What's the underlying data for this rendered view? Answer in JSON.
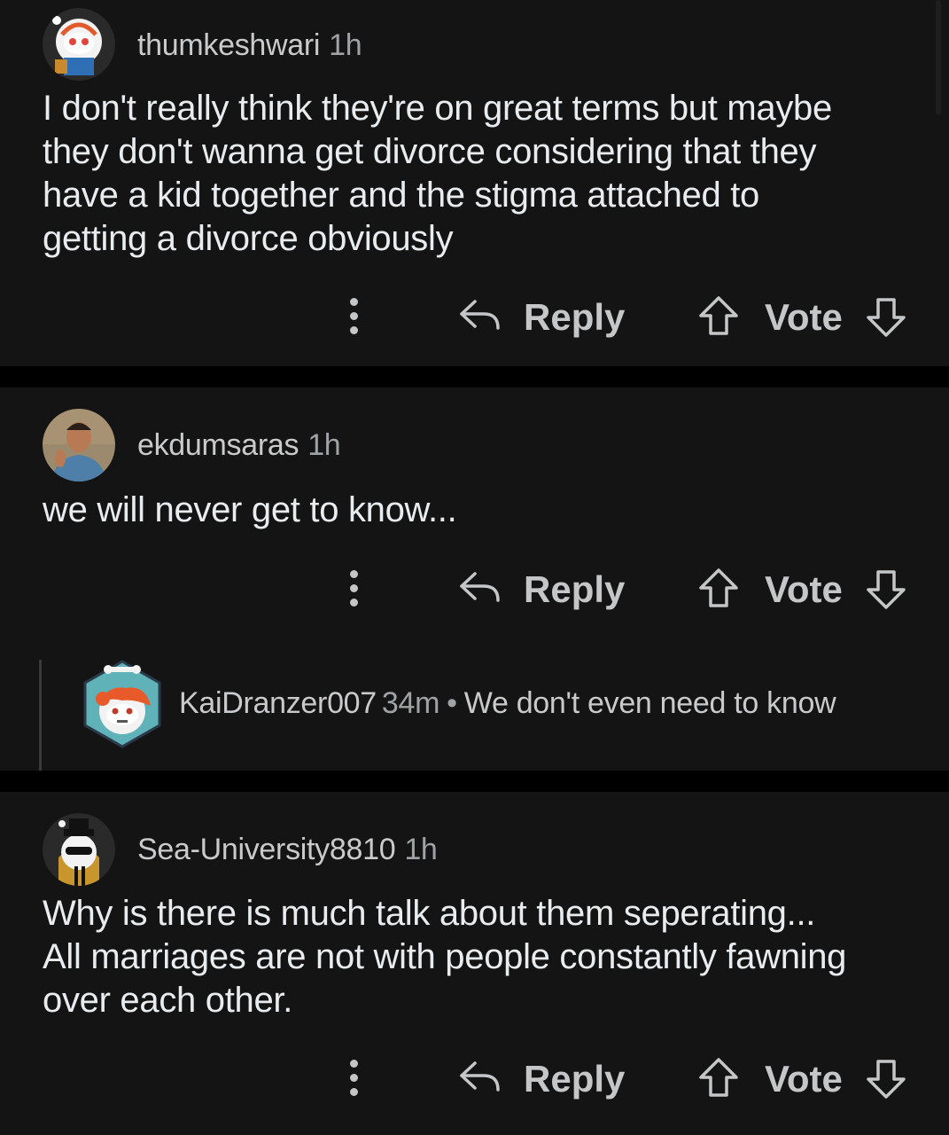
{
  "comments": [
    {
      "username": "thumkeshwari",
      "time": "1h",
      "lines": [
        "I don't really think they're on great terms but maybe",
        "they don't wanna get divorce considering that they",
        "have a kid together and the stigma attached to",
        "getting a divorce obviously"
      ],
      "reply_label": "Reply",
      "vote_label": "Vote"
    },
    {
      "username": "ekdumsaras",
      "time": "1h",
      "lines": [
        "we will never get to know..."
      ],
      "reply_label": "Reply",
      "vote_label": "Vote",
      "collapsed_reply": {
        "username": "KaiDranzer007",
        "time": "34m",
        "separator": "•",
        "preview": "We don't even need to know"
      }
    },
    {
      "username": "Sea-University8810",
      "time": "1h",
      "lines": [
        "Why is there is much talk about them seperating...",
        "All marriages are not with people constantly fawning",
        "over each other."
      ],
      "reply_label": "Reply",
      "vote_label": "Vote"
    }
  ],
  "icons": {
    "more": "vertical-dots-icon",
    "reply": "reply-arrow-icon",
    "upvote": "upvote-arrow-icon",
    "downvote": "downvote-arrow-icon"
  },
  "colors": {
    "background": "#000000",
    "card": "#141414",
    "text": "#e9ecee",
    "muted": "#a0a3a6",
    "action": "#c4c6c8"
  }
}
